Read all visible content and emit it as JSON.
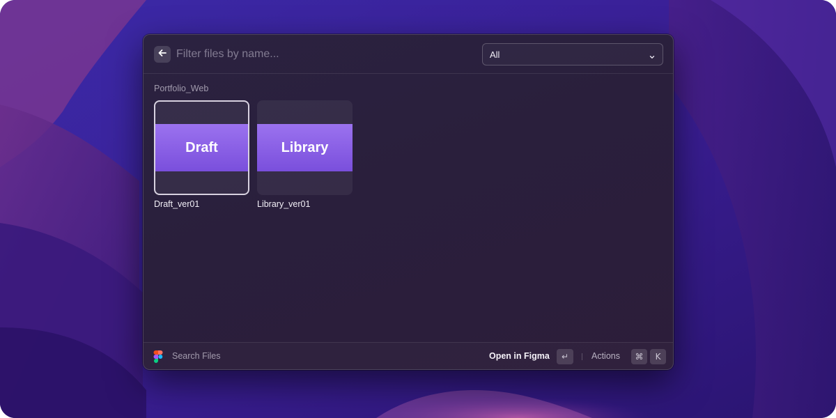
{
  "search": {
    "placeholder": "Filter files by name...",
    "filter_value": "All"
  },
  "section": {
    "title": "Portfolio_Web"
  },
  "files": [
    {
      "thumbnail_text": "Draft",
      "name": "Draft_ver01",
      "selected": true
    },
    {
      "thumbnail_text": "Library",
      "name": "Library_ver01",
      "selected": false
    }
  ],
  "footer": {
    "command_name": "Search Files",
    "primary_action": "Open in Figma",
    "primary_shortcut": "↵",
    "secondary_action": "Actions",
    "secondary_shortcut_modifier": "⌘",
    "secondary_shortcut_key": "K"
  },
  "colors": {
    "accent": "#8b5cf6",
    "thumbnail_band": "#8a60e8"
  },
  "icons": {
    "back": "arrow-left-icon",
    "dropdown": "chevron-down-icon",
    "app": "figma-icon"
  }
}
